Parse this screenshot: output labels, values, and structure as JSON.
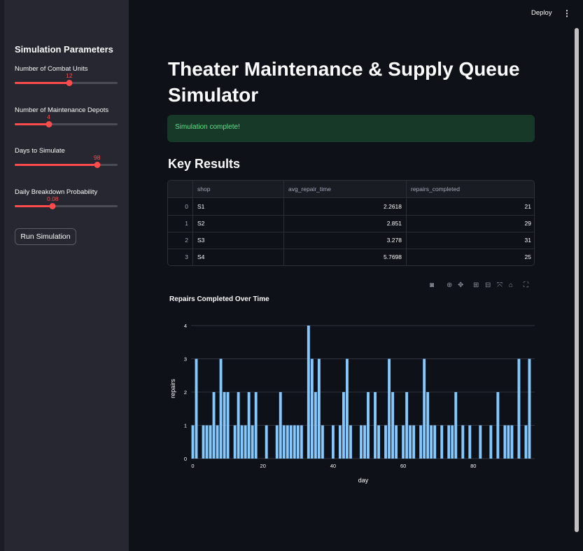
{
  "sidebar": {
    "title": "Simulation Parameters",
    "sliders": [
      {
        "label": "Number of Combat Units",
        "value": "12",
        "fraction": 0.53
      },
      {
        "label": "Number of Maintenance Depots",
        "value": "4",
        "fraction": 0.33
      },
      {
        "label": "Days to Simulate",
        "value": "98",
        "fraction": 0.8
      },
      {
        "label": "Daily Breakdown Probability",
        "value": "0.08",
        "fraction": 0.37
      }
    ],
    "run_button": "Run Simulation"
  },
  "header": {
    "deploy": "Deploy",
    "menu_icon": "kebab-menu-icon"
  },
  "main": {
    "title": "Theater Maintenance & Supply Queue Simulator",
    "alert": "Simulation complete!",
    "results_heading": "Key Results",
    "table": {
      "columns": [
        "",
        "shop",
        "avg_repair_time",
        "repairs_completed"
      ],
      "rows": [
        {
          "index": "0",
          "shop": "S1",
          "avg_repair_time": "2.2618",
          "repairs_completed": "21"
        },
        {
          "index": "1",
          "shop": "S2",
          "avg_repair_time": "2.851",
          "repairs_completed": "29"
        },
        {
          "index": "2",
          "shop": "S3",
          "avg_repair_time": "3.278",
          "repairs_completed": "31"
        },
        {
          "index": "3",
          "shop": "S4",
          "avg_repair_time": "5.7698",
          "repairs_completed": "25"
        }
      ]
    },
    "modebar_icons": [
      "camera-icon",
      "zoom-icon",
      "pan-icon",
      "zoom-in-icon",
      "zoom-out-icon",
      "autoscale-icon",
      "home-icon",
      "fullscreen-icon"
    ]
  },
  "colors": {
    "accent": "#ff4b4b",
    "bar": "#83c9ff",
    "success_text": "#5ce488"
  },
  "chart_data": {
    "type": "bar",
    "title": "Repairs Completed Over Time",
    "xlabel": "day",
    "ylabel": "repairs",
    "x": [
      0,
      1,
      2,
      3,
      4,
      5,
      6,
      7,
      8,
      9,
      10,
      11,
      12,
      13,
      14,
      15,
      16,
      17,
      18,
      19,
      20,
      21,
      22,
      23,
      24,
      25,
      26,
      27,
      28,
      29,
      30,
      31,
      32,
      33,
      34,
      35,
      36,
      37,
      38,
      39,
      40,
      41,
      42,
      43,
      44,
      45,
      46,
      47,
      48,
      49,
      50,
      51,
      52,
      53,
      54,
      55,
      56,
      57,
      58,
      59,
      60,
      61,
      62,
      63,
      64,
      65,
      66,
      67,
      68,
      69,
      70,
      71,
      72,
      73,
      74,
      75,
      76,
      77,
      78,
      79,
      80,
      81,
      82,
      83,
      84,
      85,
      86,
      87,
      88,
      89,
      90,
      91,
      92,
      93,
      94,
      95,
      96,
      97
    ],
    "values": [
      1,
      3,
      0,
      1,
      1,
      1,
      2,
      1,
      3,
      2,
      2,
      0,
      1,
      2,
      1,
      1,
      2,
      1,
      2,
      0,
      0,
      1,
      0,
      0,
      1,
      2,
      1,
      1,
      1,
      1,
      1,
      1,
      0,
      4,
      3,
      2,
      3,
      1,
      0,
      0,
      1,
      0,
      1,
      2,
      3,
      1,
      0,
      0,
      1,
      1,
      2,
      0,
      2,
      1,
      0,
      1,
      3,
      2,
      1,
      0,
      1,
      2,
      1,
      1,
      0,
      1,
      3,
      2,
      1,
      1,
      0,
      1,
      0,
      1,
      1,
      2,
      0,
      1,
      0,
      1,
      0,
      0,
      1,
      0,
      0,
      1,
      0,
      2,
      0,
      1,
      1,
      1,
      0,
      3,
      0,
      1,
      3,
      0
    ],
    "xlim": [
      -0.5,
      97.5
    ],
    "ylim": [
      0,
      4.4
    ],
    "xticks": [
      0,
      20,
      40,
      60,
      80
    ],
    "yticks": [
      0,
      1,
      2,
      3,
      4
    ],
    "grid": true
  }
}
